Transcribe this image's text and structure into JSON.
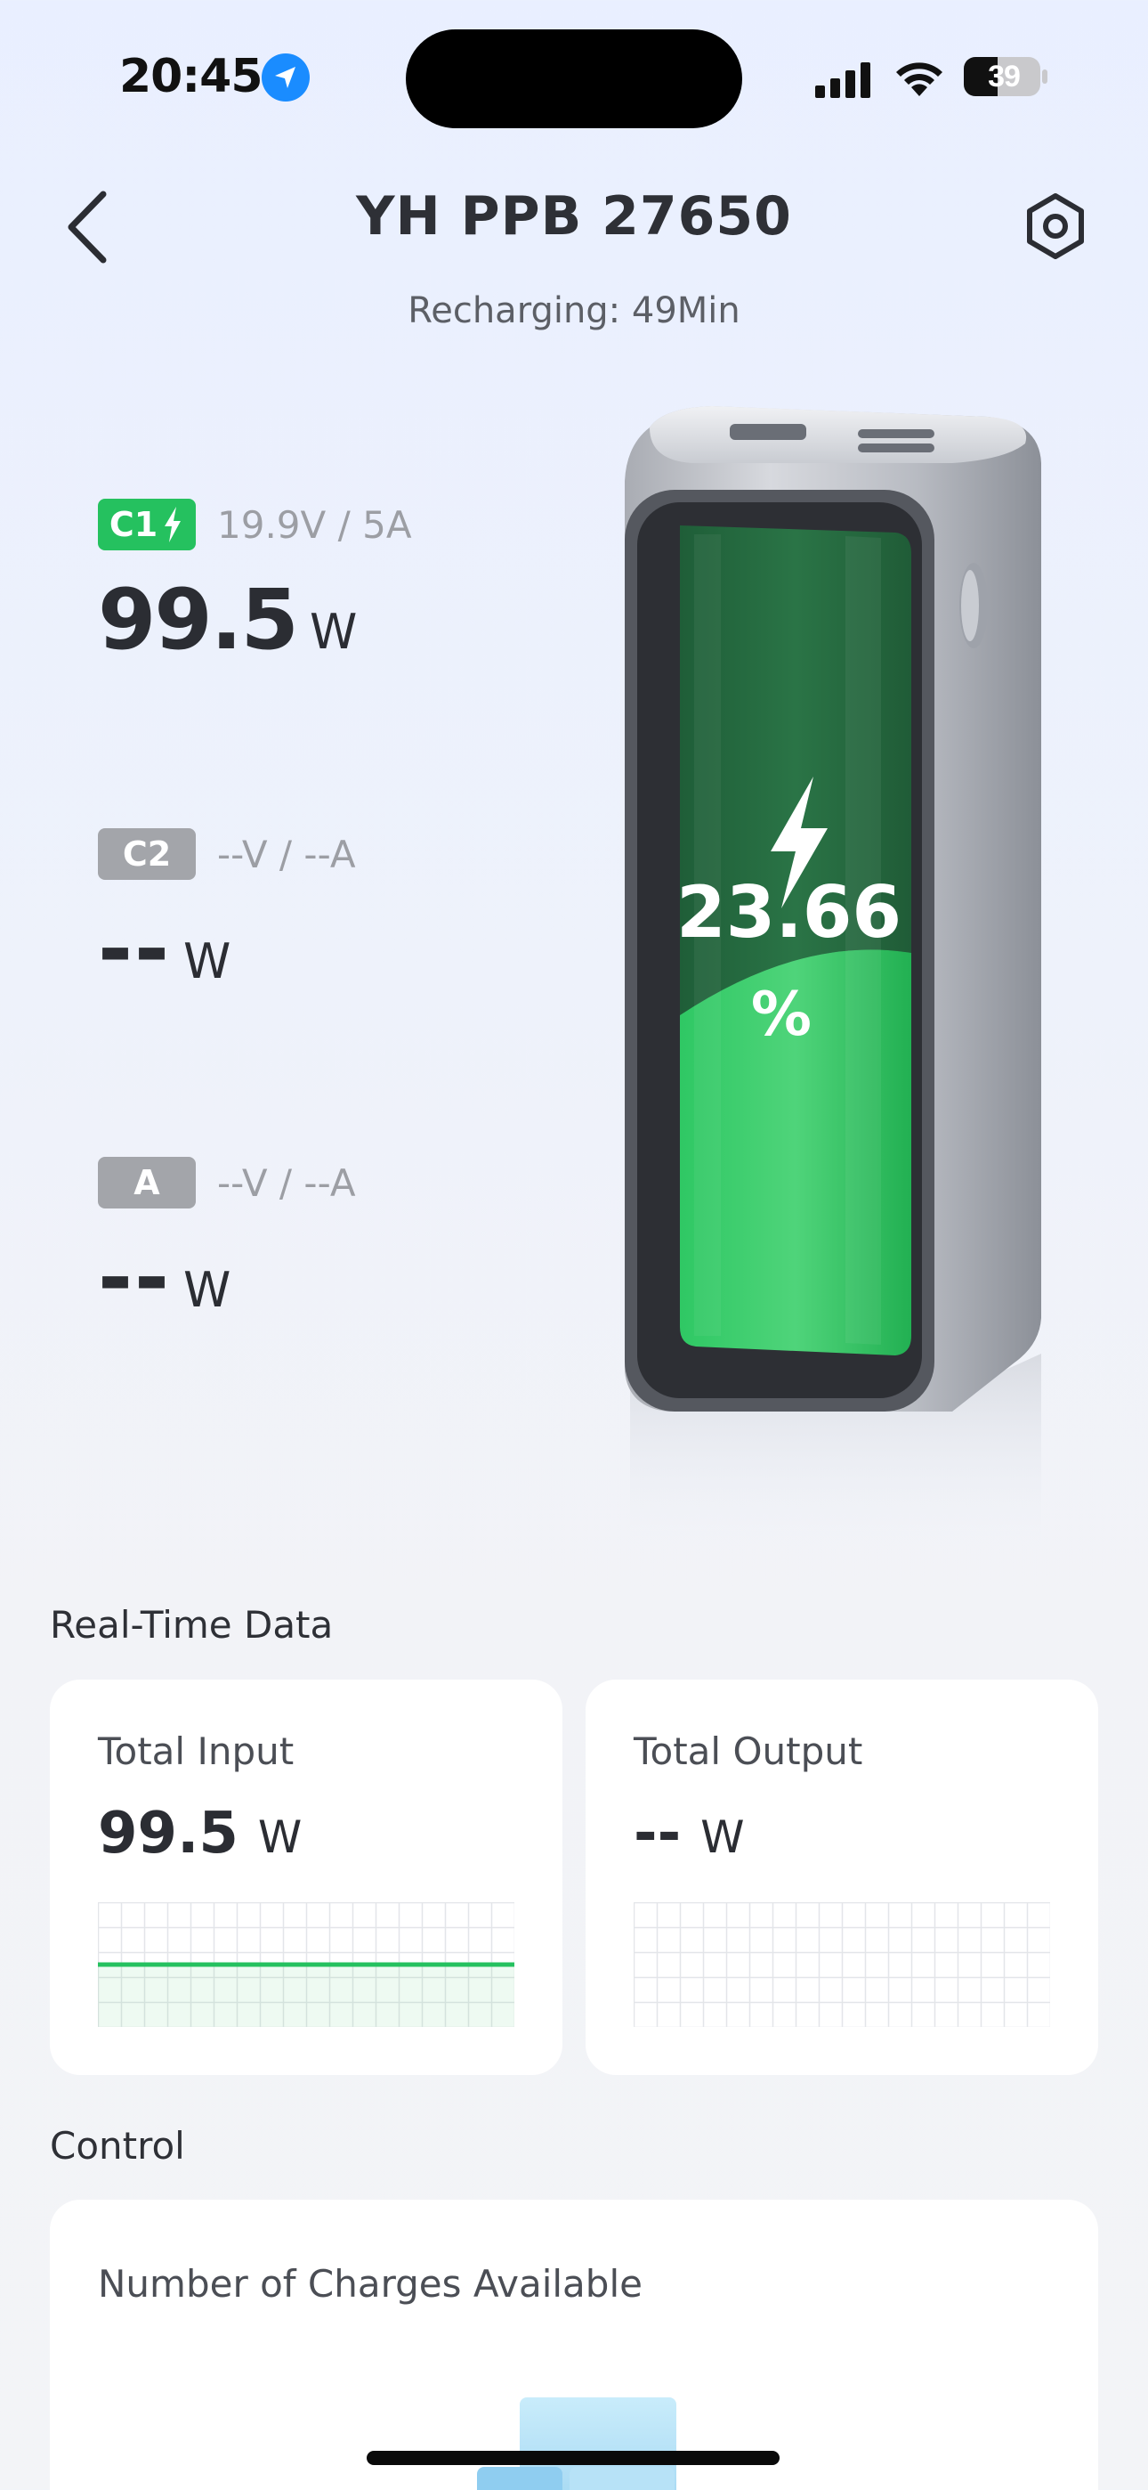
{
  "status_bar": {
    "time": "20:45",
    "battery_level": "39",
    "icons": [
      "location-arrow-icon",
      "cellular-signal-icon",
      "wifi-icon",
      "battery-icon"
    ]
  },
  "header": {
    "title": "YH PPB 27650",
    "recharge_status": "Recharging: 49Min",
    "icons": [
      "chevron-left-icon",
      "hexagon-settings-icon"
    ]
  },
  "ports": [
    {
      "name": "C1",
      "spec": "19.9V / 5A",
      "power": "99.5",
      "unit": "W",
      "active": true,
      "icon": "charging-bolt-icon"
    },
    {
      "name": "C2",
      "spec": "--V / --A",
      "power": "--",
      "unit": "W",
      "active": false
    },
    {
      "name": "A",
      "spec": "--V / --A",
      "power": "--",
      "unit": "W",
      "active": false
    }
  ],
  "device": {
    "percent": "23.66",
    "percent_sign": "%",
    "battery_fraction": 0.2366
  },
  "realtime": {
    "title": "Real-Time Data",
    "input": {
      "label": "Total Input",
      "value": "99.5",
      "unit": "W",
      "trend_level": 0.5
    },
    "output": {
      "label": "Total Output",
      "value": "--",
      "unit": "W"
    }
  },
  "control": {
    "title": "Control",
    "charges_label": "Number of Charges Available"
  },
  "colors": {
    "accent_green": "#25c15f",
    "inactive_gray": "#a3a5aa",
    "location_blue": "#1a8cff"
  }
}
